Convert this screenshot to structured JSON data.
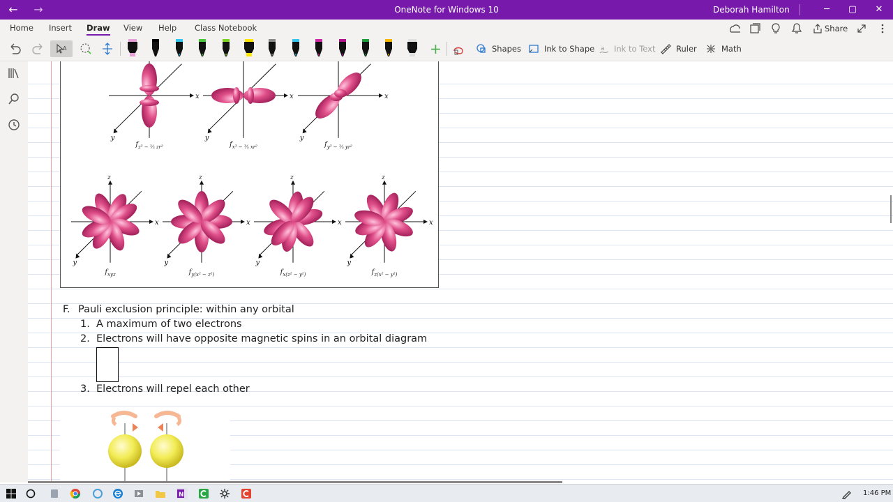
{
  "titlebar": {
    "title": "OneNote for Windows 10",
    "user": "Deborah Hamilton",
    "back_glyph": "←",
    "forward_glyph": "→",
    "minimize_glyph": "─",
    "maximize_glyph": "▢",
    "close_glyph": "✕"
  },
  "menu": {
    "tabs": [
      "Home",
      "Insert",
      "Draw",
      "View",
      "Help",
      "Class Notebook"
    ],
    "active_tab": "Draw",
    "share_label": "Share",
    "accent": "#7719aa"
  },
  "ribbon": {
    "shapes_label": "Shapes",
    "ink_to_shape_label": "Ink to Shape",
    "ink_to_text_label": "Ink to Text",
    "ruler_label": "Ruler",
    "math_label": "Math",
    "add_pen_glyph": "+",
    "pens": [
      {
        "type": "highlighter",
        "color": "#e8a0d8"
      },
      {
        "type": "pen",
        "color": "#000000"
      },
      {
        "type": "pen",
        "color": "#33c4f0"
      },
      {
        "type": "pen",
        "color": "#4cc83c"
      },
      {
        "type": "pen",
        "color": "#7ad321"
      },
      {
        "type": "highlighter",
        "color": "#ffe600"
      },
      {
        "type": "pen",
        "color": "#8a8a8a"
      },
      {
        "type": "pen",
        "color": "#33c4f0"
      },
      {
        "type": "pen",
        "color": "#cc2ca0"
      },
      {
        "type": "pen",
        "color": "#b0138a"
      },
      {
        "type": "pen",
        "color": "#1f9d3a"
      },
      {
        "type": "pen",
        "color": "#f5b800"
      },
      {
        "type": "highlighter",
        "color": "#e0e0e0"
      }
    ]
  },
  "figure": {
    "row1": [
      {
        "label": "f",
        "sub": "z³ − ⅗ zr²"
      },
      {
        "label": "f",
        "sub": "x³ − ⅗ xr²"
      },
      {
        "label": "f",
        "sub": "y³ − ⅗ yr²"
      }
    ],
    "row2": [
      {
        "label": "f",
        "sub": "xyz"
      },
      {
        "label": "f",
        "sub": "y(x² − z²)"
      },
      {
        "label": "f",
        "sub": "x(z² − y²)"
      },
      {
        "label": "f",
        "sub": "z(x² − y²)"
      }
    ],
    "axis_x": "x",
    "axis_y": "y",
    "axis_z": "z",
    "lobe_color": "#e0508a"
  },
  "notes": {
    "f_marker": "F.",
    "f_text": "Pauli exclusion principle: within any orbital",
    "items": [
      {
        "num": "1.",
        "text": "A maximum of two electrons"
      },
      {
        "num": "2.",
        "text": "Electrons will have opposite magnetic spins in an orbital diagram"
      },
      {
        "num": "3.",
        "text": "Electrons will repel each other"
      }
    ]
  },
  "taskbar": {
    "time": "1:46 PM"
  }
}
